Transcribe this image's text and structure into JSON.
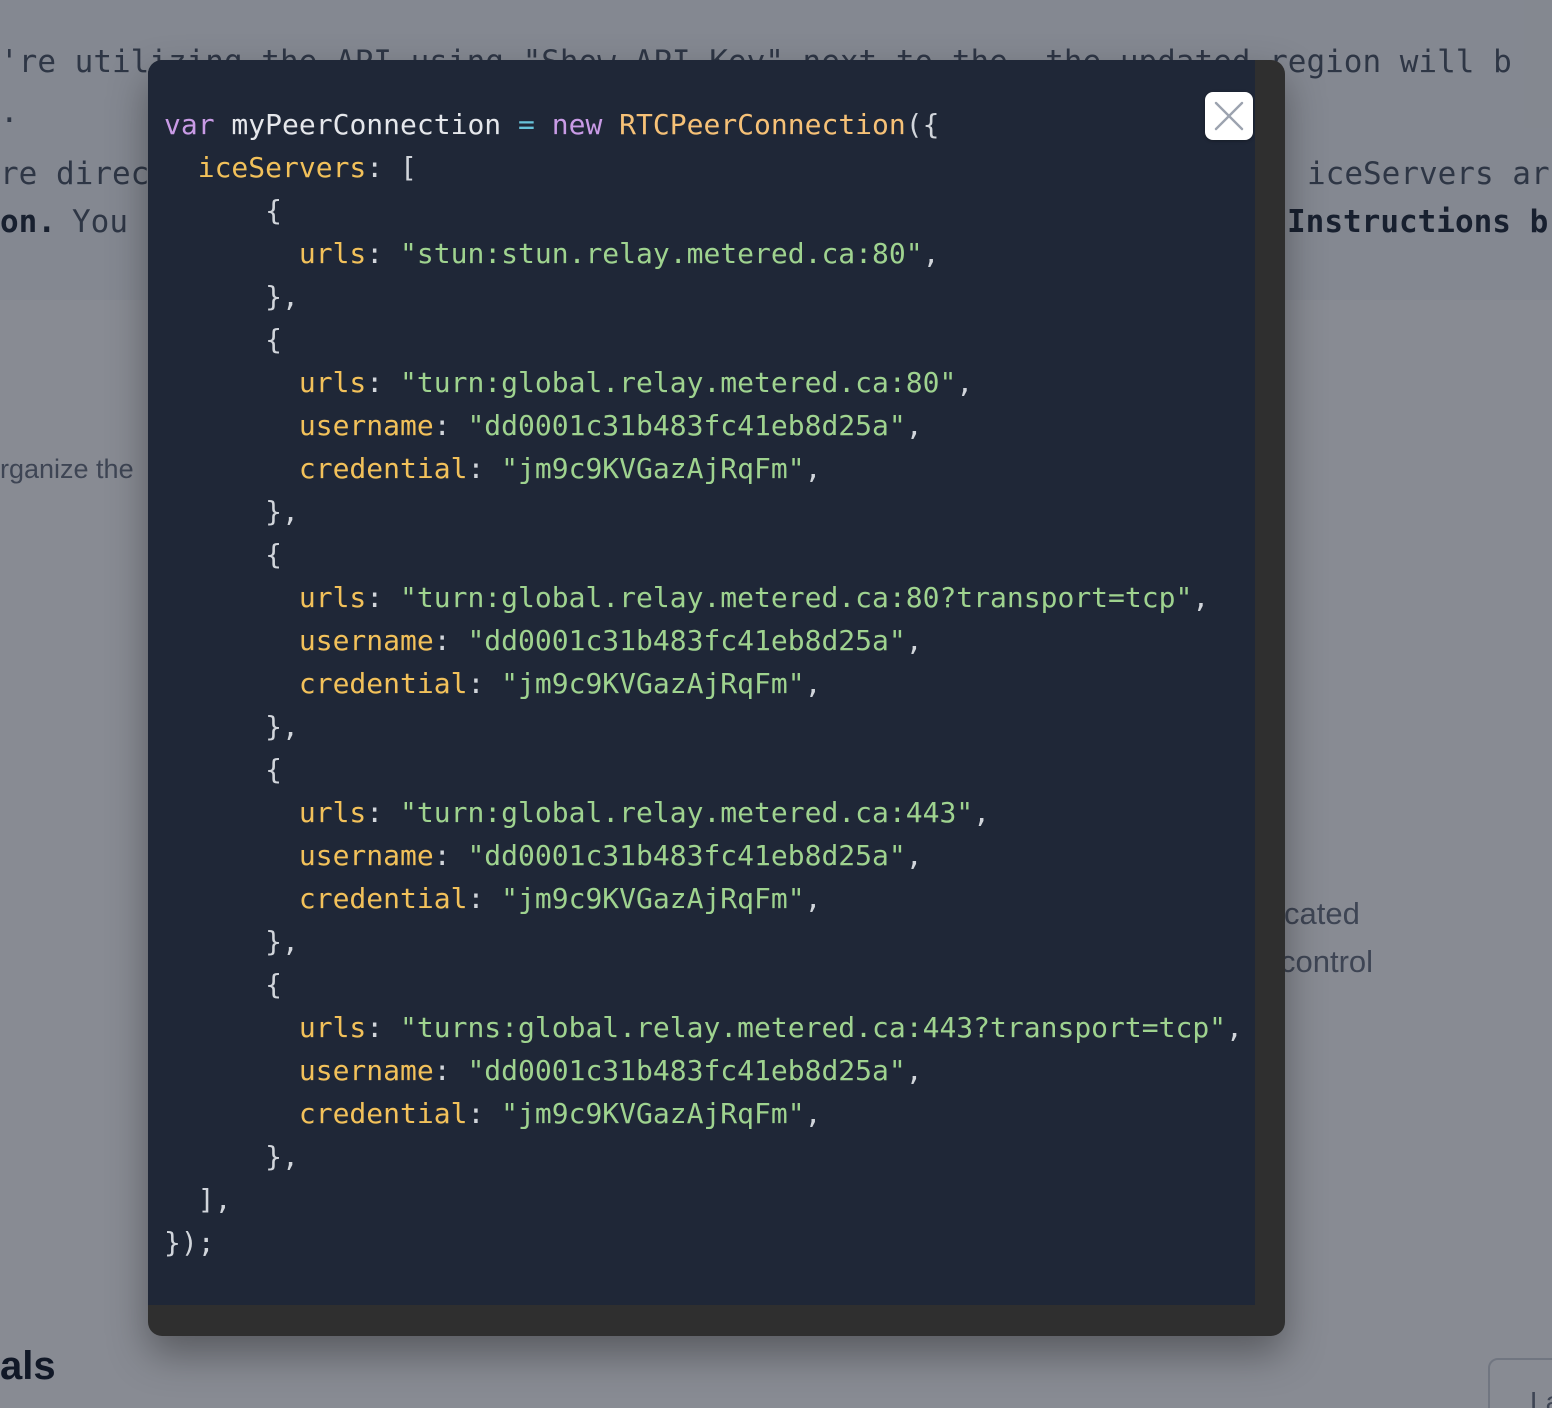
{
  "background": {
    "text_lines": [
      "'re utilizing the API using \"Show API Key\" next to the  the updated region will b",
      ".",
      "re direc",
      "iceServers ar",
      "on.",
      "You",
      "Instructions b"
    ],
    "side_texts": [
      "rganize the",
      "cated",
      "control"
    ],
    "heading": "als",
    "button_label": "La"
  },
  "modal": {
    "close_icon": "close-icon",
    "code": {
      "language": "javascript",
      "lines": [
        [
          [
            "kw",
            "var"
          ],
          [
            "plain",
            " myPeerConnection "
          ],
          [
            "op",
            "="
          ],
          [
            "plain",
            " "
          ],
          [
            "kw",
            "new"
          ],
          [
            "plain",
            " "
          ],
          [
            "fn",
            "RTCPeerConnection"
          ],
          [
            "punc",
            "({"
          ]
        ],
        [
          [
            "plain",
            "  "
          ],
          [
            "prop",
            "iceServers"
          ],
          [
            "punc",
            ": ["
          ]
        ],
        [
          [
            "plain",
            "      "
          ],
          [
            "punc",
            "{"
          ]
        ],
        [
          [
            "plain",
            "        "
          ],
          [
            "prop",
            "urls"
          ],
          [
            "punc",
            ": "
          ],
          [
            "str",
            "\"stun:stun.relay.metered.ca:80\""
          ],
          [
            "punc",
            ","
          ]
        ],
        [
          [
            "plain",
            "      "
          ],
          [
            "punc",
            "},"
          ]
        ],
        [
          [
            "plain",
            "      "
          ],
          [
            "punc",
            "{"
          ]
        ],
        [
          [
            "plain",
            "        "
          ],
          [
            "prop",
            "urls"
          ],
          [
            "punc",
            ": "
          ],
          [
            "str",
            "\"turn:global.relay.metered.ca:80\""
          ],
          [
            "punc",
            ","
          ]
        ],
        [
          [
            "plain",
            "        "
          ],
          [
            "prop",
            "username"
          ],
          [
            "punc",
            ": "
          ],
          [
            "str",
            "\"dd0001c31b483fc41eb8d25a\""
          ],
          [
            "punc",
            ","
          ]
        ],
        [
          [
            "plain",
            "        "
          ],
          [
            "prop",
            "credential"
          ],
          [
            "punc",
            ": "
          ],
          [
            "str",
            "\"jm9c9KVGazAjRqFm\""
          ],
          [
            "punc",
            ","
          ]
        ],
        [
          [
            "plain",
            "      "
          ],
          [
            "punc",
            "},"
          ]
        ],
        [
          [
            "plain",
            "      "
          ],
          [
            "punc",
            "{"
          ]
        ],
        [
          [
            "plain",
            "        "
          ],
          [
            "prop",
            "urls"
          ],
          [
            "punc",
            ": "
          ],
          [
            "str",
            "\"turn:global.relay.metered.ca:80?transport=tcp\""
          ],
          [
            "punc",
            ","
          ]
        ],
        [
          [
            "plain",
            "        "
          ],
          [
            "prop",
            "username"
          ],
          [
            "punc",
            ": "
          ],
          [
            "str",
            "\"dd0001c31b483fc41eb8d25a\""
          ],
          [
            "punc",
            ","
          ]
        ],
        [
          [
            "plain",
            "        "
          ],
          [
            "prop",
            "credential"
          ],
          [
            "punc",
            ": "
          ],
          [
            "str",
            "\"jm9c9KVGazAjRqFm\""
          ],
          [
            "punc",
            ","
          ]
        ],
        [
          [
            "plain",
            "      "
          ],
          [
            "punc",
            "},"
          ]
        ],
        [
          [
            "plain",
            "      "
          ],
          [
            "punc",
            "{"
          ]
        ],
        [
          [
            "plain",
            "        "
          ],
          [
            "prop",
            "urls"
          ],
          [
            "punc",
            ": "
          ],
          [
            "str",
            "\"turn:global.relay.metered.ca:443\""
          ],
          [
            "punc",
            ","
          ]
        ],
        [
          [
            "plain",
            "        "
          ],
          [
            "prop",
            "username"
          ],
          [
            "punc",
            ": "
          ],
          [
            "str",
            "\"dd0001c31b483fc41eb8d25a\""
          ],
          [
            "punc",
            ","
          ]
        ],
        [
          [
            "plain",
            "        "
          ],
          [
            "prop",
            "credential"
          ],
          [
            "punc",
            ": "
          ],
          [
            "str",
            "\"jm9c9KVGazAjRqFm\""
          ],
          [
            "punc",
            ","
          ]
        ],
        [
          [
            "plain",
            "      "
          ],
          [
            "punc",
            "},"
          ]
        ],
        [
          [
            "plain",
            "      "
          ],
          [
            "punc",
            "{"
          ]
        ],
        [
          [
            "plain",
            "        "
          ],
          [
            "prop",
            "urls"
          ],
          [
            "punc",
            ": "
          ],
          [
            "str",
            "\"turns:global.relay.metered.ca:443?transport=tcp\""
          ],
          [
            "punc",
            ","
          ]
        ],
        [
          [
            "plain",
            "        "
          ],
          [
            "prop",
            "username"
          ],
          [
            "punc",
            ": "
          ],
          [
            "str",
            "\"dd0001c31b483fc41eb8d25a\""
          ],
          [
            "punc",
            ","
          ]
        ],
        [
          [
            "plain",
            "        "
          ],
          [
            "prop",
            "credential"
          ],
          [
            "punc",
            ": "
          ],
          [
            "str",
            "\"jm9c9KVGazAjRqFm\""
          ],
          [
            "punc",
            ","
          ]
        ],
        [
          [
            "plain",
            "      "
          ],
          [
            "punc",
            "},"
          ]
        ],
        [
          [
            "plain",
            "  "
          ],
          [
            "punc",
            "],"
          ]
        ],
        [
          [
            "punc",
            "});"
          ]
        ]
      ]
    }
  },
  "colors": {
    "code_background": "#1f2737",
    "modal_frame": "#2f2f2f",
    "keyword": "#c99be6",
    "function": "#f6c177",
    "property": "#f2c15a",
    "string": "#9fd38f",
    "operator": "#67c2d8"
  }
}
